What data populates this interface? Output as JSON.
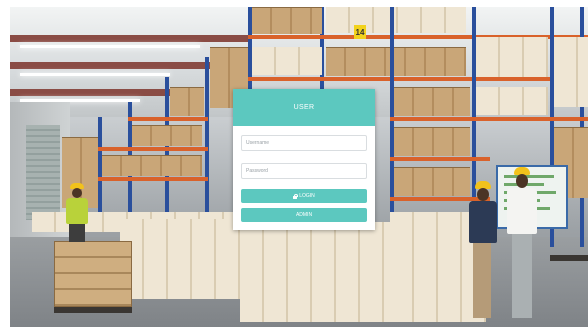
{
  "login": {
    "title": "USER",
    "username_placeholder": "Username",
    "password_placeholder": "Password",
    "login_label": "LOGIN",
    "admin_label": "ADMIN",
    "lock_icon": "lock-icon"
  },
  "colors": {
    "accent": "#5cc8bf",
    "card": "#ffffff"
  },
  "background": {
    "rack_sign": "14"
  }
}
